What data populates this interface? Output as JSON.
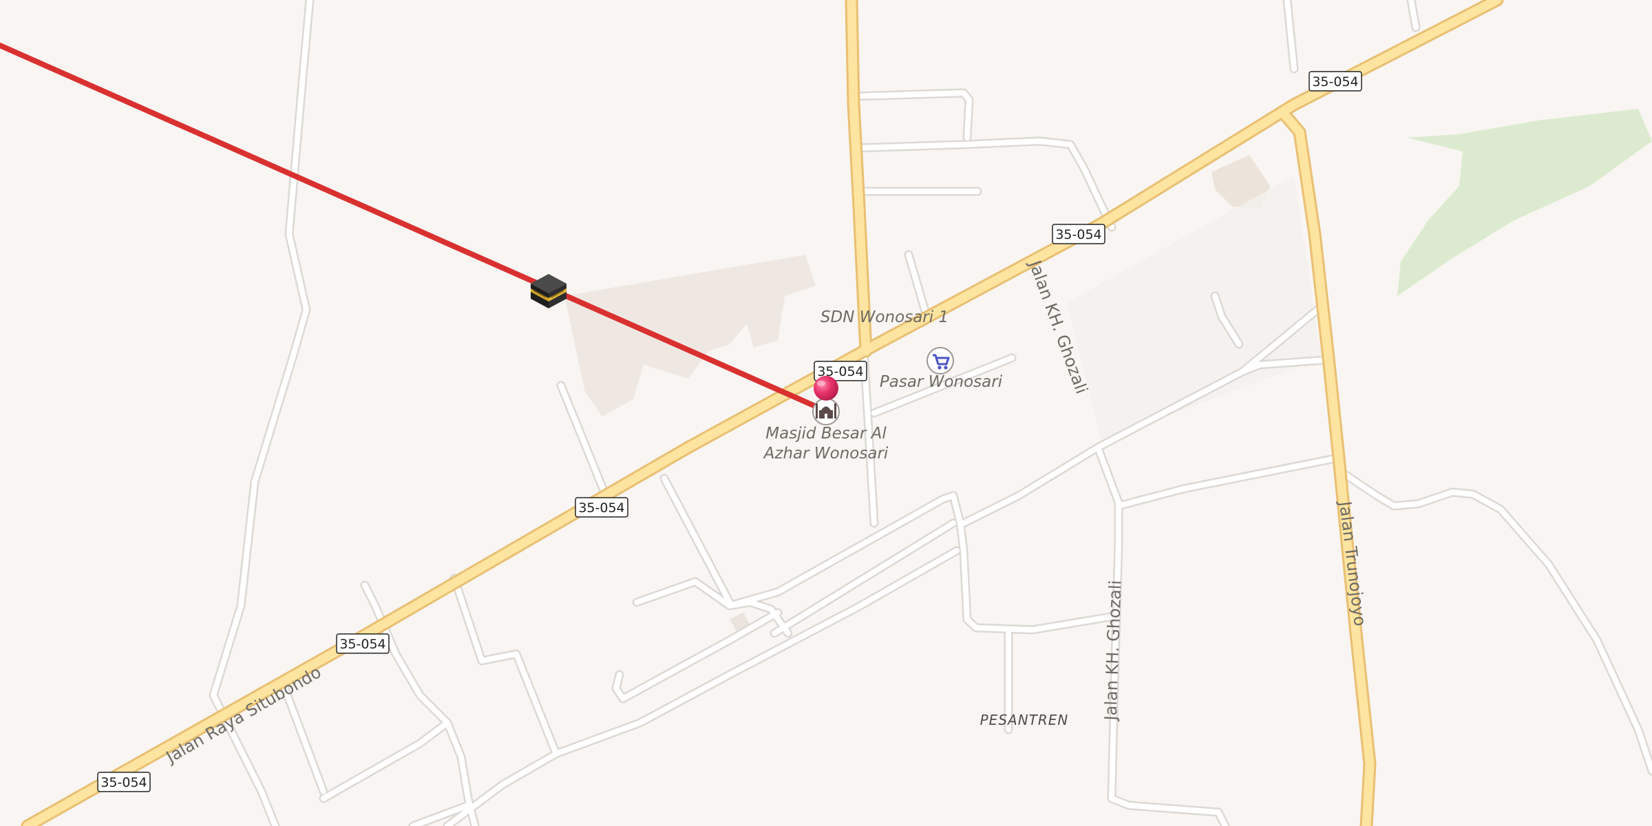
{
  "map": {
    "road_shield": "35-054",
    "roads": {
      "main": "Jalan Raya Situbondo",
      "ghozali_north": "Jalan KH. Ghozali",
      "ghozali_south": "Jalan KH. Ghozali",
      "trunojoyo": "Jalan Trunojoyo"
    },
    "pois": {
      "school": "SDN Wonosari 1",
      "market": "Pasar Wonosari",
      "mosque_line1": "Masjid Besar Al",
      "mosque_line2": "Azhar Wonosari"
    },
    "area": "PESANTREN",
    "icons": {
      "kaaba": "kaaba-icon",
      "location_pin": "location-pin-icon",
      "mosque": "mosque-icon",
      "shopping_cart": "shopping-cart-icon"
    },
    "colors": {
      "background": "#f8f5f2",
      "major_road": "#fde4a0",
      "major_road_casing": "#e9bf72",
      "minor_road": "#ffffff",
      "minor_road_casing": "#dcd9d5",
      "qibla_line": "#d93030",
      "pin": "#e8336a",
      "park": "#dcebcf",
      "building_area": "#efe8e2"
    }
  }
}
